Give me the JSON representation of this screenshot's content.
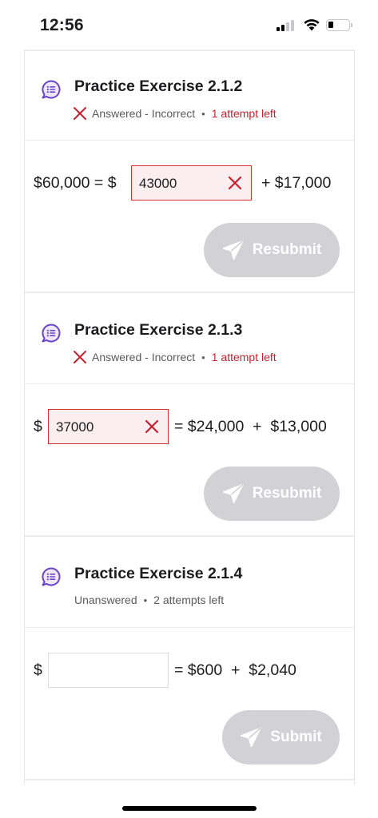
{
  "status_bar": {
    "time": "12:56",
    "icons": [
      "cellular-signal-icon",
      "wifi-icon",
      "battery-icon"
    ]
  },
  "colors": {
    "incorrect_red": "#c8202f",
    "input_error_border": "#d0342c",
    "input_error_fill": "#fbeef0",
    "disabled_button": "#d1d1d6",
    "exercise_icon": "#6b45c9"
  },
  "exercises": [
    {
      "title": "Practice Exercise 2.1.2",
      "status": "Answered - Incorrect",
      "separator": "•",
      "attempts": "1 attempt left",
      "equation": {
        "lhs": "$60,000 = $",
        "answer": "43000",
        "rhs": "+ $17,000"
      },
      "button": "Resubmit"
    },
    {
      "title": "Practice Exercise 2.1.3",
      "status": "Answered - Incorrect",
      "separator": "•",
      "attempts": "1 attempt left",
      "equation": {
        "lhs": "$",
        "answer": "37000",
        "rhs": "= $24,000  +  $13,000"
      },
      "button": "Resubmit"
    },
    {
      "title": "Practice Exercise 2.1.4",
      "status": "Unanswered",
      "separator": "•",
      "attempts": "2 attempts left",
      "equation": {
        "lhs": "$",
        "answer": "",
        "rhs": "= $600  +  $2,040"
      },
      "button": "Submit"
    }
  ]
}
